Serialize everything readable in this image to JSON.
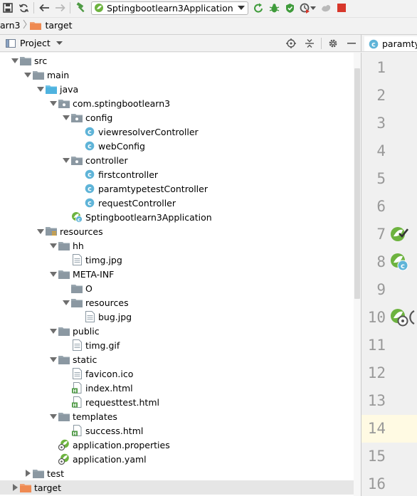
{
  "toolbar": {
    "run_config_label": "Sptingbootlearn3Application",
    "icons": [
      "save-icon",
      "sync-icon",
      "back-icon",
      "forward-icon",
      "build-hammer-icon",
      "spring-boot-icon",
      "chevron-down-icon",
      "rerun-icon",
      "debug-bug-icon",
      "coverage-icon",
      "profile-icon",
      "chevron-down-icon",
      "attach-icon",
      "stop-icon"
    ]
  },
  "breadcrumb": {
    "project": "arn3",
    "folder": "target"
  },
  "project_panel": {
    "title": "Project",
    "tree": [
      {
        "label": "src",
        "icon": "folder",
        "depth": 1,
        "arrow": "expanded"
      },
      {
        "label": "main",
        "icon": "folder",
        "depth": 2,
        "arrow": "expanded"
      },
      {
        "label": "java",
        "icon": "source-folder",
        "depth": 3,
        "arrow": "expanded"
      },
      {
        "label": "com.sptingbootlearn3",
        "icon": "package",
        "depth": 4,
        "arrow": "expanded"
      },
      {
        "label": "config",
        "icon": "package",
        "depth": 5,
        "arrow": "expanded"
      },
      {
        "label": "viewresolverController",
        "icon": "class",
        "depth": 6,
        "arrow": "none"
      },
      {
        "label": "webConfig",
        "icon": "class",
        "depth": 6,
        "arrow": "none"
      },
      {
        "label": "controller",
        "icon": "package",
        "depth": 5,
        "arrow": "expanded"
      },
      {
        "label": "firstcontroller",
        "icon": "class",
        "depth": 6,
        "arrow": "none"
      },
      {
        "label": "paramtypetestController",
        "icon": "class",
        "depth": 6,
        "arrow": "none"
      },
      {
        "label": "requestController",
        "icon": "class",
        "depth": 6,
        "arrow": "none"
      },
      {
        "label": "Sptingbootlearn3Application",
        "icon": "spring-class",
        "depth": 5,
        "arrow": "none"
      },
      {
        "label": "resources",
        "icon": "resources-folder",
        "depth": 3,
        "arrow": "expanded"
      },
      {
        "label": "hh",
        "icon": "folder",
        "depth": 4,
        "arrow": "expanded"
      },
      {
        "label": "timg.jpg",
        "icon": "image-file",
        "depth": 5,
        "arrow": "none"
      },
      {
        "label": "META-INF",
        "icon": "folder",
        "depth": 4,
        "arrow": "expanded"
      },
      {
        "label": "O",
        "icon": "folder",
        "depth": 5,
        "arrow": "none"
      },
      {
        "label": "resources",
        "icon": "folder",
        "depth": 5,
        "arrow": "expanded"
      },
      {
        "label": "bug.jpg",
        "icon": "image-file",
        "depth": 6,
        "arrow": "none"
      },
      {
        "label": "public",
        "icon": "folder",
        "depth": 4,
        "arrow": "expanded"
      },
      {
        "label": "timg.gif",
        "icon": "image-file",
        "depth": 5,
        "arrow": "none"
      },
      {
        "label": "static",
        "icon": "folder",
        "depth": 4,
        "arrow": "expanded"
      },
      {
        "label": "favicon.ico",
        "icon": "image-file",
        "depth": 5,
        "arrow": "none"
      },
      {
        "label": "index.html",
        "icon": "html-file",
        "depth": 5,
        "arrow": "none"
      },
      {
        "label": "requesttest.html",
        "icon": "html-file",
        "depth": 5,
        "arrow": "none"
      },
      {
        "label": "templates",
        "icon": "folder",
        "depth": 4,
        "arrow": "expanded"
      },
      {
        "label": "success.html",
        "icon": "html-file",
        "depth": 5,
        "arrow": "none"
      },
      {
        "label": "application.properties",
        "icon": "spring-config",
        "depth": 4,
        "arrow": "none"
      },
      {
        "label": "application.yaml",
        "icon": "spring-config",
        "depth": 4,
        "arrow": "none"
      },
      {
        "label": "test",
        "icon": "folder",
        "depth": 2,
        "arrow": "collapsed"
      },
      {
        "label": "target",
        "icon": "excluded-folder",
        "depth": 1,
        "arrow": "collapsed",
        "selected": true
      }
    ]
  },
  "editor": {
    "tab_label": "paramtyp",
    "line_numbers": [
      "1",
      "2",
      "3",
      "4",
      "5",
      "6",
      "7",
      "8",
      "9",
      "10",
      "11",
      "12",
      "13",
      "14",
      "15",
      "16"
    ],
    "current_line": "14",
    "gutter_marks": {
      "7": "spring-check",
      "8": "spring-c",
      "10": "spring-globe"
    }
  }
}
